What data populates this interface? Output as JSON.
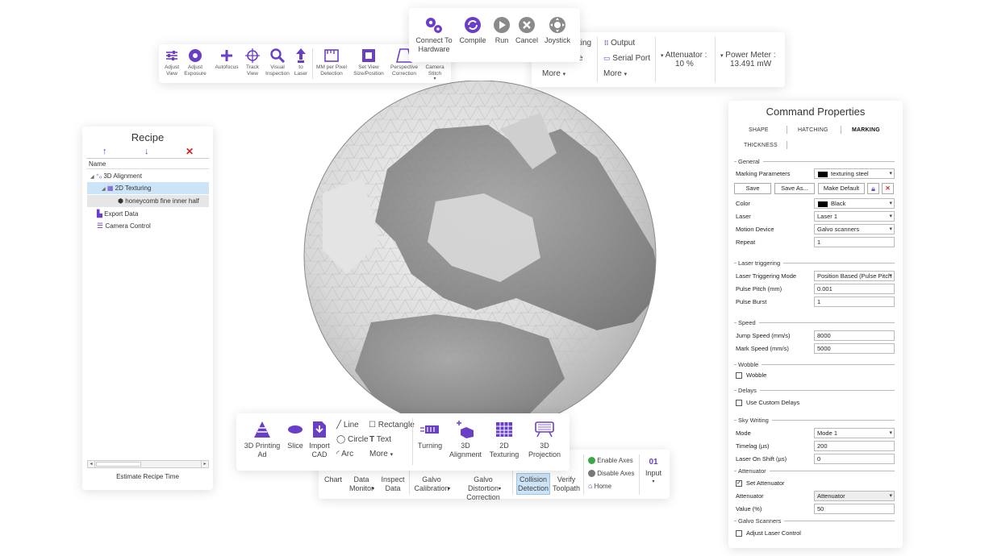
{
  "camera_toolbar": {
    "adjust_view": "Adjust View",
    "adjust_exposure": "Adjust Exposure",
    "autofocus": "Autofocus",
    "track_view": "Track View",
    "visual_inspection": "Visual Inspection",
    "to_laser": "to Laser",
    "mm_per_pixel": "MM per Pixel Detection",
    "set_view": "Set View Size/Position",
    "perspective": "Perspective Correction",
    "camera_stitch": "Camera Stitch"
  },
  "hardware_toolbar": {
    "connect": "Connect To Hardware",
    "compile": "Compile",
    "run": "Run",
    "cancel": "Cancel",
    "joystick": "Joystick"
  },
  "output_toolbar": {
    "partial_label_1": "ting",
    "partial_label_2": "e",
    "more_left": "More",
    "output": "Output",
    "serial_port": "Serial Port",
    "more_right": "More",
    "attenuator_label": "Attenuator :",
    "attenuator_value": "10 %",
    "power_meter_label": "Power Meter :",
    "power_meter_value": "13.491 mW"
  },
  "recipe": {
    "title": "Recipe",
    "column_name": "Name",
    "items": [
      {
        "label": "3D Alignment"
      },
      {
        "label": "2D Texturing"
      },
      {
        "label": "honeycomb fine inner half"
      },
      {
        "label": "Export Data"
      },
      {
        "label": "Camera Control"
      }
    ],
    "estimate": "Estimate Recipe Time"
  },
  "shapes_toolbar": {
    "printing": "3D Printing Ad",
    "slice": "Slice",
    "import_cad": "Import CAD",
    "line": "Line",
    "rectangle": "Rectangle",
    "circle": "Circle",
    "text": "Text",
    "arc": "Arc",
    "more": "More",
    "turning": "Turning",
    "alignment_3d": "3D Alignment",
    "texturing_2d": "2D Texturing",
    "projection_3d": "3D Projection"
  },
  "bottom_toolbar": {
    "chart": "Chart",
    "data_monitor": "Data Monitor",
    "inspect_data": "Inspect Data",
    "galvo_calibration": "Galvo Calibration",
    "galvo_distortion": "Galvo Distortion Correction",
    "collision": "Collision Detection",
    "verify": "Verify Toolpath",
    "enable_axes": "Enable Axes",
    "disable_axes": "Disable Axes",
    "home": "Home",
    "input": "Input"
  },
  "props": {
    "title": "Command Properties",
    "tabs": [
      "SHAPE",
      "HATCHING",
      "MARKING",
      "THICKNESS"
    ],
    "general": "General",
    "marking_parameters_label": "Marking Parameters",
    "marking_parameters_value": "texturing steel",
    "save": "Save",
    "save_as": "Save As...",
    "make_default": "Make Default",
    "color_label": "Color",
    "color_value": "Black",
    "laser_label": "Laser",
    "laser_value": "Laser 1",
    "motion_label": "Motion Device",
    "motion_value": "Galvo scanners",
    "repeat_label": "Repeat",
    "repeat_value": "1",
    "laser_triggering": "Laser triggering",
    "trigger_mode_label": "Laser Triggering Mode",
    "trigger_mode_value": "Position Based (Pulse Pitch",
    "pulse_pitch_label": "Pulse Pitch (mm)",
    "pulse_pitch_value": "0.001",
    "pulse_burst_label": "Pulse Burst",
    "pulse_burst_value": "1",
    "speed": "Speed",
    "jump_label": "Jump Speed (mm/s)",
    "jump_value": "8000",
    "mark_label": "Mark Speed (mm/s)",
    "mark_value": "5000",
    "wobble_section": "Wobble",
    "wobble_label": "Wobble",
    "delays_section": "Delays",
    "custom_delays": "Use Custom Delays",
    "sky_writing": "Sky Writing",
    "mode_label": "Mode",
    "mode_value": "Mode 1",
    "timelag_label": "Timelag (µs)",
    "timelag_value": "200",
    "laser_on_shift_label": "Laser On Shift (µs)",
    "laser_on_shift_value": "0",
    "attenuator_section": "Attenuator",
    "set_attenuator": "Set Attenuator",
    "attenuator_label": "Attenuator",
    "attenuator_value": "Attenuator",
    "value_label": "Value (%)",
    "value_value": "50",
    "galvo_scanners": "Galvo Scanners",
    "adjust_laser": "Adjust Laser Control"
  },
  "colors": {
    "accent": "#6a3fc8",
    "selection": "#cce4f7",
    "delete": "#d42020",
    "axes_on": "#3aa84a",
    "axes_off": "#777777"
  }
}
